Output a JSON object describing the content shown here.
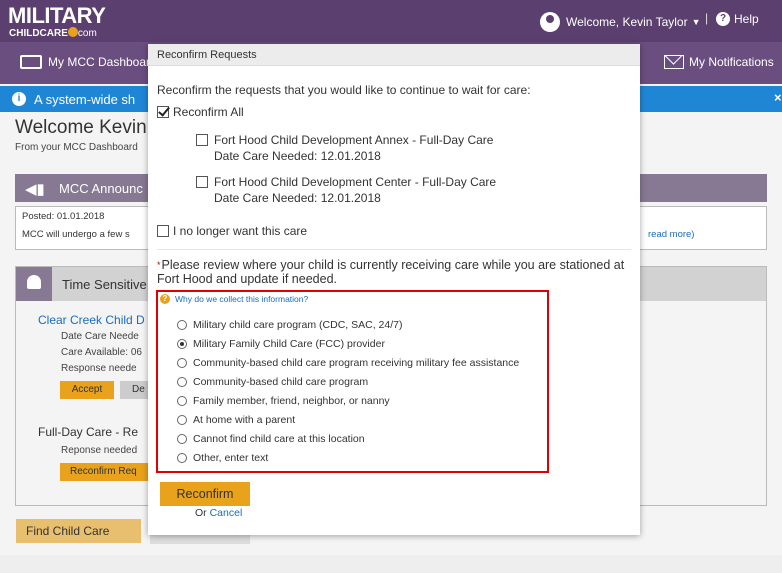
{
  "header": {
    "logo_line1": "MILITARY",
    "logo_line2": "CHILDCARE",
    "logo_com": "com",
    "welcome": "Welcome, Kevin Taylor",
    "separator": "|",
    "help": "Help"
  },
  "nav": {
    "dashboard": "My MCC Dashboard",
    "notifications": "My Notifications"
  },
  "alert": {
    "text": "A system-wide sh",
    "close": "×"
  },
  "dashboard": {
    "welcome": "Welcome Kevin!",
    "sub": "From your MCC Dashboard",
    "announcements": {
      "title": "MCC Announc",
      "posted": "Posted: 01.01.2018",
      "message": "MCC will undergo a few s",
      "read_more": "read more)"
    },
    "time_sensitive": {
      "title": "Time Sensitive",
      "link": "Clear Creek Child D",
      "lines": [
        "Date Care Neede",
        "Care Available: 06",
        "Response neede"
      ],
      "accept": "Accept",
      "decline": "De",
      "fdc_title": "Full-Day Care  - Re",
      "response": "Reponse needed",
      "reconfirm": "Reconfirm Req"
    },
    "find_child_care": "Find Child Care"
  },
  "modal": {
    "title": "Reconfirm Requests",
    "intro": "Reconfirm the requests that you would like to continue to wait for care:",
    "reconfirm_all": "Reconfirm All",
    "requests": [
      {
        "name": "Fort Hood Child Development Annex  - Full-Day Care",
        "date": "Date Care Needed: 12.01.2018"
      },
      {
        "name": "Fort Hood Child Development Center  - Full-Day Care",
        "date": "Date Care Needed: 12.01.2018"
      }
    ],
    "no_longer": "I no longer want this care",
    "required_mark": "*",
    "review": "Please review where your child is currently receiving care while you are stationed at Fort Hood and update if needed.",
    "why": "Why do we collect this information?",
    "options": [
      "Military child care program (CDC, SAC, 24/7)",
      "Military Family Child Care (FCC) provider",
      "Community-based child care program receiving military fee assistance",
      "Community-based child care program",
      "Family member, friend, neighbor, or nanny",
      "At home with a parent",
      "Cannot find child care at this location",
      "Other, enter text"
    ],
    "selected_option_index": 1,
    "reconfirm_button": "Reconfirm",
    "or": "Or ",
    "cancel": "Cancel"
  },
  "colors": {
    "header": "#5b3f6f",
    "accent": "#e8a21c",
    "alert": "#1f86d6",
    "highlight_border": "#e10000"
  }
}
